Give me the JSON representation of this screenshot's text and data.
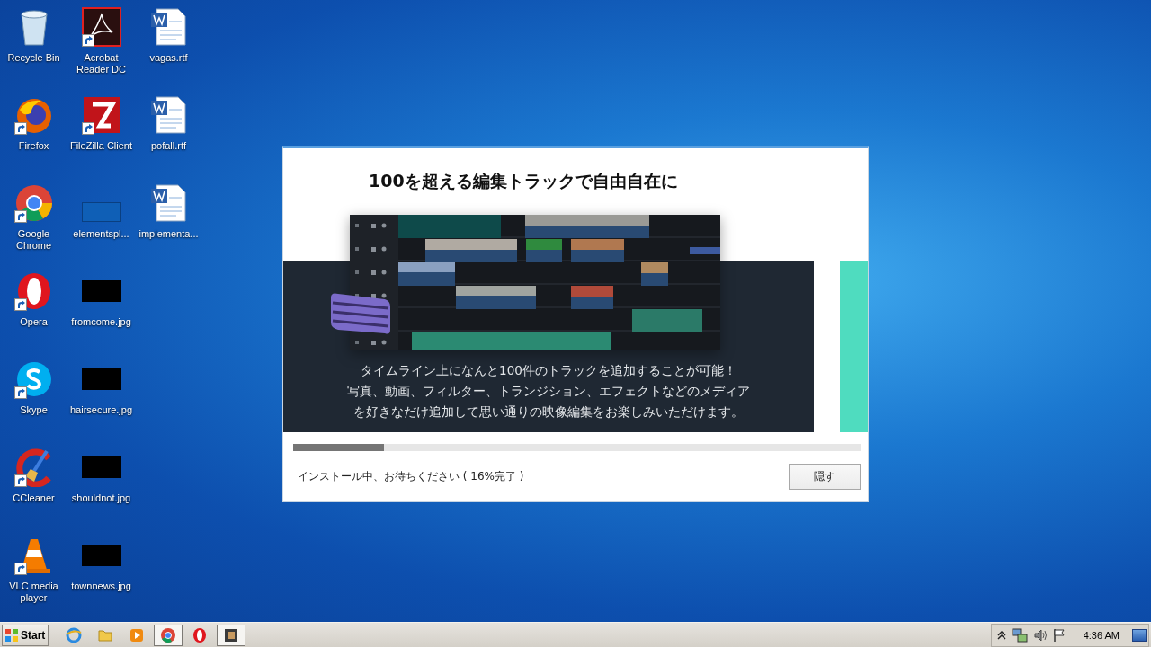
{
  "desktop": {
    "columns": [
      [
        {
          "label": "Recycle Bin",
          "kind": "recycle",
          "shortcut": false
        },
        {
          "label": "Firefox",
          "kind": "firefox",
          "shortcut": true
        },
        {
          "label": "Google Chrome",
          "kind": "chrome",
          "shortcut": true
        },
        {
          "label": "Opera",
          "kind": "opera",
          "shortcut": true
        },
        {
          "label": "Skype",
          "kind": "skype",
          "shortcut": true
        },
        {
          "label": "CCleaner",
          "kind": "ccleaner",
          "shortcut": true
        },
        {
          "label": "VLC media player",
          "kind": "vlc",
          "shortcut": true
        }
      ],
      [
        {
          "label": "Acrobat Reader DC",
          "kind": "pdf",
          "shortcut": true
        },
        {
          "label": "FileZilla Client",
          "kind": "filezilla",
          "shortcut": true
        },
        {
          "label": "elementspl...",
          "kind": "blank",
          "shortcut": false
        },
        {
          "label": "fromcome.jpg",
          "kind": "image",
          "shortcut": false
        },
        {
          "label": "hairsecure.jpg",
          "kind": "image",
          "shortcut": false
        },
        {
          "label": "shouldnot.jpg",
          "kind": "image",
          "shortcut": false
        },
        {
          "label": "townnews.jpg",
          "kind": "image",
          "shortcut": false
        }
      ],
      [
        {
          "label": "vagas.rtf",
          "kind": "word",
          "shortcut": false
        },
        {
          "label": "pofall.rtf",
          "kind": "word",
          "shortcut": false
        },
        {
          "label": "implementa...",
          "kind": "word",
          "shortcut": false
        }
      ]
    ]
  },
  "installer": {
    "title": "100を超える編集トラックで自由自在に",
    "banner_lines": [
      "タイムライン上になんと100件のトラックを追加することが可能！",
      "写真、動画、フィルター、トランジション、エフェクトなどのメディア",
      "を好きなだけ追加して思い通りの映像編集をお楽しみいただけます。"
    ],
    "progress": {
      "level": 0.16
    },
    "status": "インストール中、お待ちください ( 16%完了 )",
    "button": "隠す"
  },
  "taskbar": {
    "start": "Start",
    "apps": [
      {
        "kind": "ie",
        "open": false
      },
      {
        "kind": "folder",
        "open": false
      },
      {
        "kind": "media",
        "open": false
      },
      {
        "kind": "chrome",
        "open": true
      },
      {
        "kind": "opera",
        "open": false
      },
      {
        "kind": "installer",
        "open": true
      }
    ],
    "clock": "4:36 AM"
  }
}
